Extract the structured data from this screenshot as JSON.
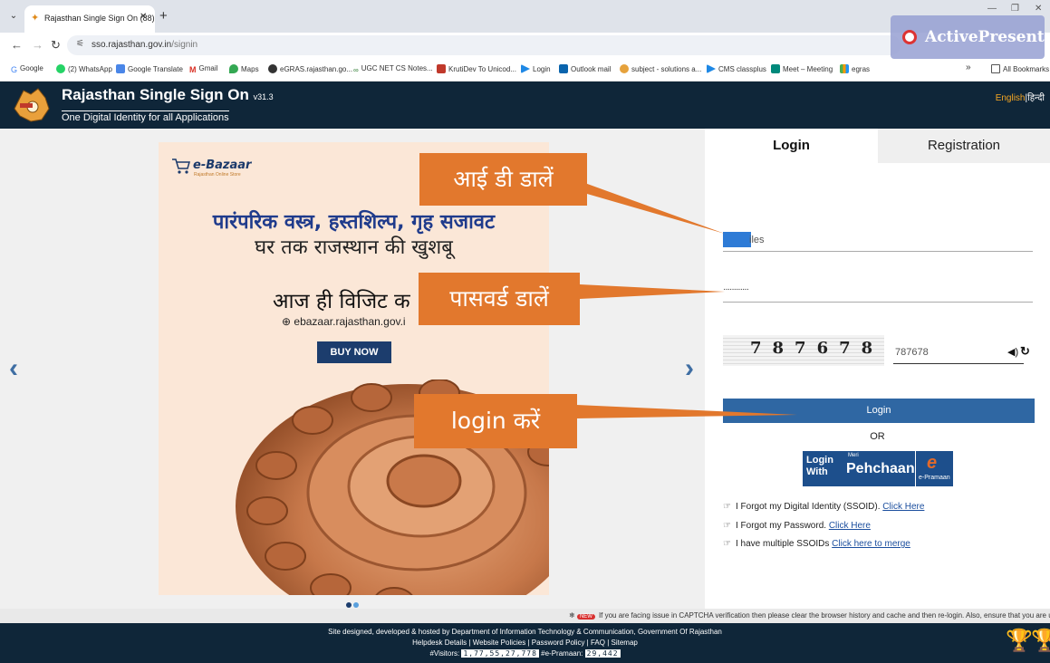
{
  "browser": {
    "tab_title": "Rajasthan Single Sign On (88)",
    "url_host": "sso.rajasthan.gov.in",
    "url_path": "/signin",
    "bookmarks": [
      {
        "label": "Google"
      },
      {
        "label": "(2) WhatsApp"
      },
      {
        "label": "Google Translate"
      },
      {
        "label": "Gmail"
      },
      {
        "label": "Maps"
      },
      {
        "label": "eGRAS.rajasthan.go..."
      },
      {
        "label": "UGC NET CS Notes..."
      },
      {
        "label": "KrutiDev To Unicod..."
      },
      {
        "label": "Login"
      },
      {
        "label": "Outlook mail"
      },
      {
        "label": "subject - solutions a..."
      },
      {
        "label": "CMS classplus"
      },
      {
        "label": "Meet – Meeting"
      },
      {
        "label": "egras"
      }
    ],
    "more_bookmarks": "»",
    "all_bookmarks": "All Bookmarks"
  },
  "watermark": {
    "text": "ActivePresenter"
  },
  "header": {
    "title": "Rajasthan Single Sign On",
    "version": "v31.3",
    "subtitle": "One Digital Identity for all Applications",
    "lang_en": "English",
    "lang_sep": "|",
    "lang_hi": "हिन्दी"
  },
  "banner": {
    "logo_name": "e-Bazaar",
    "logo_tag": "Rajasthan Online Store",
    "line1": "पारंपरिक वस्त्र, हस्तशिल्प, गृह सजावट",
    "line2": "घर तक राजस्थान की खुशबू",
    "line3": "आज ही विजिट क",
    "url": "ebazaar.rajasthan.gov.i",
    "cta": "BUY NOW"
  },
  "login": {
    "tab_login": "Login",
    "tab_registration": "Registration",
    "id_value": "iles",
    "password_value": "············",
    "captcha_digits": "787678",
    "captcha_input": "787678",
    "login_button": "Login",
    "or_text": "OR",
    "pehchaan_login_with": "Login With",
    "pehchaan_meri": "Meri",
    "pehchaan_name": "Pehchaan",
    "epramaan": "e-Pramaan",
    "forgot_id_text": "I Forgot my Digital Identity (SSOID).",
    "forgot_id_link": "Click Here",
    "forgot_pw_text": "I Forgot my Password.",
    "forgot_pw_link": "Click Here",
    "multi_text": "I have multiple SSOIDs",
    "multi_link": "Click here to merge"
  },
  "callouts": {
    "id": "आई डी डालें",
    "password": "पासवर्ड डालें",
    "login": "login करें"
  },
  "ticker": {
    "badge": "NEW",
    "message": "If you are facing issue in CAPTCHA verification then please clear the browser history and cache and then re-login. Also, ensure that you are using late"
  },
  "footer": {
    "line1": "Site designed, developed & hosted by Department of Information Technology & Communication, Government Of Rajasthan",
    "line2": "Helpdesk Details | Website Policies | Password Policy | FAQ | Sitemap",
    "visitors_label": "#Visitors:",
    "visitors_count": "1,77,55,27,778",
    "epramaan_label": "#e-Pramaan:",
    "epramaan_count": "29,442"
  },
  "colors": {
    "header_bg": "#0f2639",
    "callout": "#e2782d",
    "login_btn": "#2f67a3"
  }
}
